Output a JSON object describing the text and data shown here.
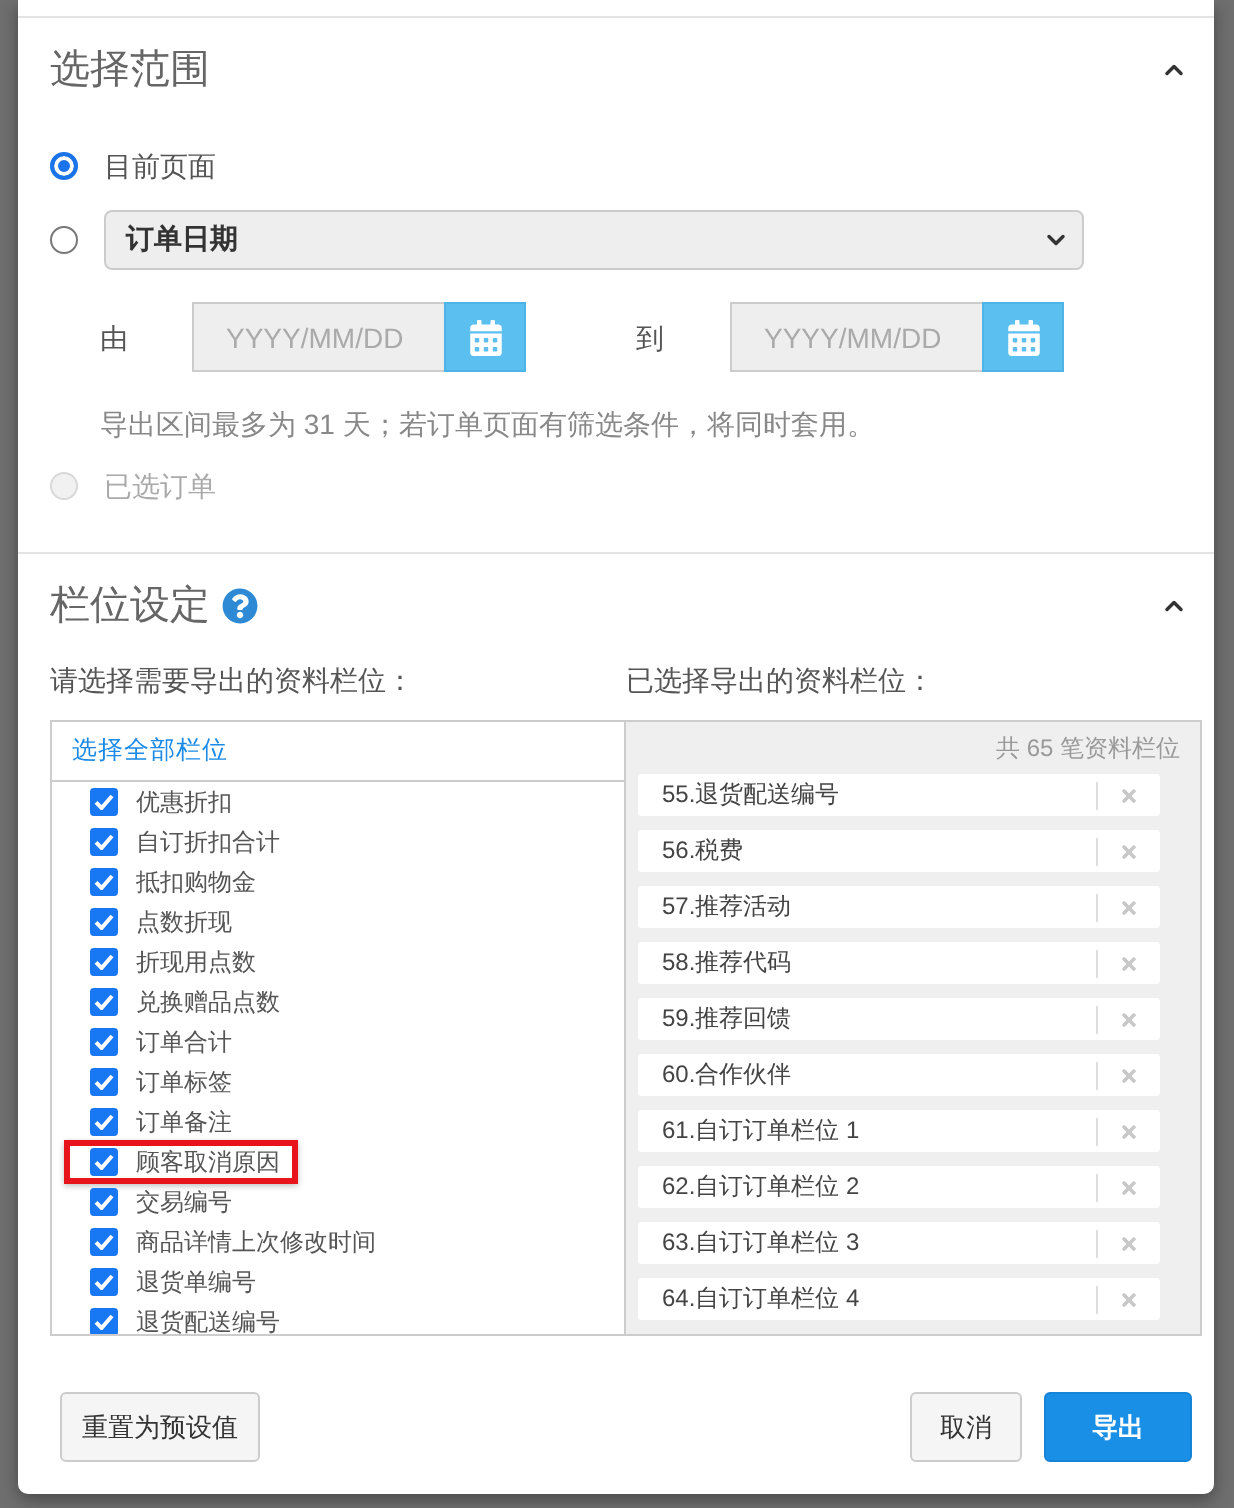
{
  "range": {
    "title": "选择范围",
    "expanded": true,
    "options": [
      {
        "kind": "radio",
        "label": "目前页面",
        "selected": true,
        "disabled": false
      },
      {
        "kind": "date_select",
        "value": "订单日期",
        "selected": false,
        "disabled": false,
        "dates": [
          {
            "label": "由",
            "placeholder": "YYYY/MM/DD"
          },
          {
            "label": "到",
            "placeholder": "YYYY/MM/DD"
          }
        ],
        "hint": "导出区间最多为 31 天；若订单页面有筛选条件，将同时套用。"
      },
      {
        "kind": "radio",
        "label": "已选订单",
        "selected": false,
        "disabled": true
      }
    ]
  },
  "columns": {
    "title": "栏位设定",
    "expanded": true,
    "available": {
      "heading": "请选择需要导出的资料栏位：",
      "select_all": "选择全部栏位",
      "items": [
        {
          "label": "优惠折扣",
          "checked": true,
          "highlighted": false
        },
        {
          "label": "自订折扣合计",
          "checked": true,
          "highlighted": false
        },
        {
          "label": "抵扣购物金",
          "checked": true,
          "highlighted": false
        },
        {
          "label": "点数折现",
          "checked": true,
          "highlighted": false
        },
        {
          "label": "折现用点数",
          "checked": true,
          "highlighted": false
        },
        {
          "label": "兑换赠品点数",
          "checked": true,
          "highlighted": false
        },
        {
          "label": "订单合计",
          "checked": true,
          "highlighted": false
        },
        {
          "label": "订单标签",
          "checked": true,
          "highlighted": false
        },
        {
          "label": "订单备注",
          "checked": true,
          "highlighted": false
        },
        {
          "label": "顾客取消原因",
          "checked": true,
          "highlighted": true
        },
        {
          "label": "交易编号",
          "checked": true,
          "highlighted": false
        },
        {
          "label": "商品详情上次修改时间",
          "checked": true,
          "highlighted": false
        },
        {
          "label": "退货单编号",
          "checked": true,
          "highlighted": false
        },
        {
          "label": "退货配送编号",
          "checked": true,
          "highlighted": false
        }
      ]
    },
    "chosen": {
      "heading": "已选择导出的资料栏位：",
      "count": "共 65 笔资料栏位",
      "items": [
        {
          "label": "55.退货配送编号"
        },
        {
          "label": "56.税费"
        },
        {
          "label": "57.推荐活动"
        },
        {
          "label": "58.推荐代码"
        },
        {
          "label": "59.推荐回馈"
        },
        {
          "label": "60.合作伙伴"
        },
        {
          "label": "61.自订订单栏位 1"
        },
        {
          "label": "62.自订订单栏位 2"
        },
        {
          "label": "63.自订订单栏位 3"
        },
        {
          "label": "64.自订订单栏位 4"
        }
      ]
    }
  },
  "footer": {
    "buttons": [
      {
        "label": "重置为预设值",
        "kind": "default"
      },
      {
        "label": "取消",
        "kind": "default"
      },
      {
        "label": "导出",
        "kind": "primary"
      }
    ]
  }
}
